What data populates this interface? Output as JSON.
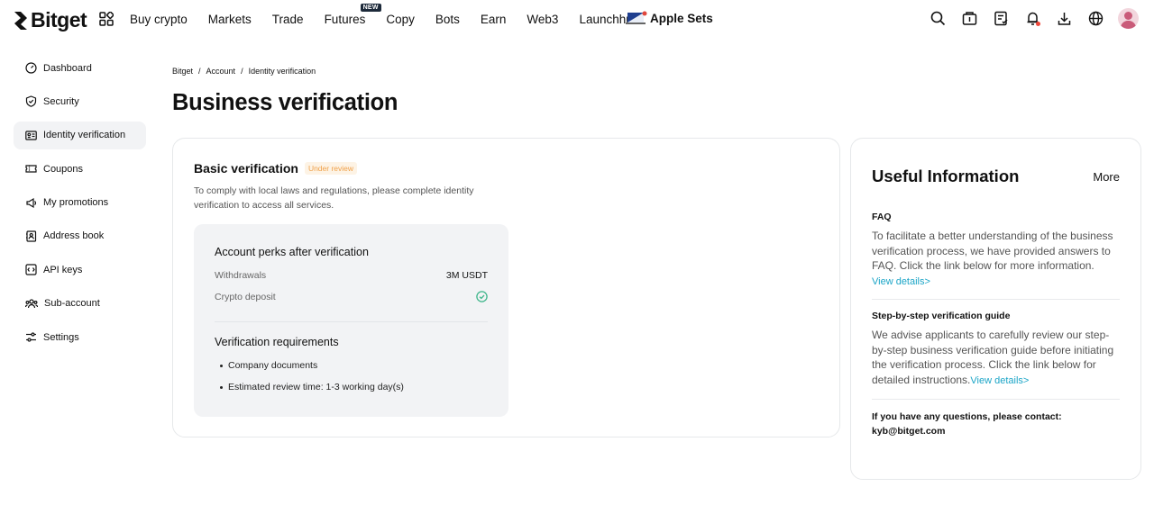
{
  "header": {
    "logo_text": "Bitget",
    "nav": [
      {
        "label": "Buy crypto"
      },
      {
        "label": "Markets"
      },
      {
        "label": "Trade"
      },
      {
        "label": "Futures",
        "badge": "NEW"
      },
      {
        "label": "Copy"
      },
      {
        "label": "Bots"
      },
      {
        "label": "Earn"
      },
      {
        "label": "Web3"
      },
      {
        "label": "Launchhub"
      }
    ],
    "promo_label": "Apple Sets",
    "icons": [
      "search-icon",
      "wallet-icon",
      "orders-icon",
      "bell-icon",
      "download-icon",
      "globe-icon",
      "avatar"
    ]
  },
  "sidebar": {
    "items": [
      {
        "label": "Dashboard",
        "icon": "dashboard-icon"
      },
      {
        "label": "Security",
        "icon": "shield-icon"
      },
      {
        "label": "Identity verification",
        "icon": "id-card-icon",
        "active": true
      },
      {
        "label": "Coupons",
        "icon": "coupon-icon"
      },
      {
        "label": "My promotions",
        "icon": "promotion-icon"
      },
      {
        "label": "Address book",
        "icon": "address-book-icon"
      },
      {
        "label": "API keys",
        "icon": "api-icon"
      },
      {
        "label": "Sub-account",
        "icon": "users-icon"
      },
      {
        "label": "Settings",
        "icon": "settings-icon"
      }
    ]
  },
  "breadcrumb": [
    "Bitget",
    "Account",
    "Identity verification"
  ],
  "page_title": "Business verification",
  "basic": {
    "title": "Basic verification",
    "status": "Under review",
    "description": "To comply with local laws and regulations, please complete identity verification to access all services.",
    "perks_title": "Account perks after verification",
    "withdrawals_label": "Withdrawals",
    "withdrawals_value": "3M USDT",
    "deposit_label": "Crypto deposit",
    "requirements_title": "Verification requirements",
    "requirements": [
      "Company documents",
      "Estimated review time: 1-3 working day(s)"
    ]
  },
  "info": {
    "title": "Useful Information",
    "more": "More",
    "faq_label": "FAQ",
    "faq_text": "To facilitate a better understanding of the business verification process, we have provided answers to FAQ. Click the link below for more information.",
    "faq_link": "View details>",
    "guide_label": "Step-by-step verification guide",
    "guide_text": "We advise applicants to carefully review our step-by-step business verification guide before initiating the verification process. Click the link below for detailed instructions.",
    "guide_link": "View details>",
    "contact_text": "If you have any questions, please contact:",
    "contact_email": "kyb@bitget.com"
  },
  "colors": {
    "accent_link": "#1ba5c7",
    "review_badge": "#f0a14a",
    "check": "#3fb68b"
  }
}
